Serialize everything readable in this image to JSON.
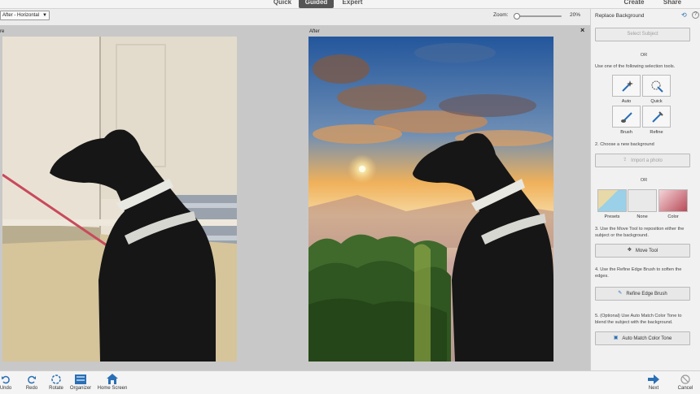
{
  "topbar": {
    "modes": [
      "Quick",
      "Guided",
      "Expert"
    ],
    "create": "Create",
    "share": "Share"
  },
  "options": {
    "view": "After - Horizontal",
    "zoom_label": "Zoom:",
    "zoom_value": "20%",
    "zoom_fraction": 0.05
  },
  "canvas": {
    "before_label": "re",
    "after_label": "After"
  },
  "panel": {
    "title": "Replace Background",
    "select_subject": "Select Subject",
    "or1": "OR",
    "tools_intro": "Use one of the following selection tools.",
    "tools": [
      {
        "label": "Auto",
        "icon": "auto-selection-icon"
      },
      {
        "label": "Quick",
        "icon": "quick-selection-icon"
      },
      {
        "label": "Brush",
        "icon": "selection-brush-icon"
      },
      {
        "label": "Refine",
        "icon": "refine-selection-icon"
      }
    ],
    "step2": "2. Choose a new background",
    "import_photo": "Import a photo",
    "or2": "OR",
    "swatches": [
      {
        "label": "Presets",
        "color": "#e8d9a8"
      },
      {
        "label": "None",
        "color": "#e9e9e9"
      },
      {
        "label": "Color",
        "color": "#b84b58"
      }
    ],
    "step3": "3. Use the Move Tool to reposition either the subject or the background.",
    "move_tool": "Move Tool",
    "step4": "4. Use the Refine Edge Brush to soften the edges.",
    "refine_edge": "Refine Edge Brush",
    "step5": "5. (Optional) Use Auto Match Color Tone to blend the subject with the background.",
    "auto_match": "Auto Match Color Tone"
  },
  "bottombar": {
    "undo": "Undo",
    "redo": "Redo",
    "rotate": "Rotate",
    "organizer": "Organizer",
    "home": "Home Screen",
    "next": "Next",
    "cancel": "Cancel"
  },
  "colors": {
    "accent": "#2a6fb5",
    "panel_bg": "#f1f1f1",
    "canvas_bg": "#c8c8c8"
  }
}
